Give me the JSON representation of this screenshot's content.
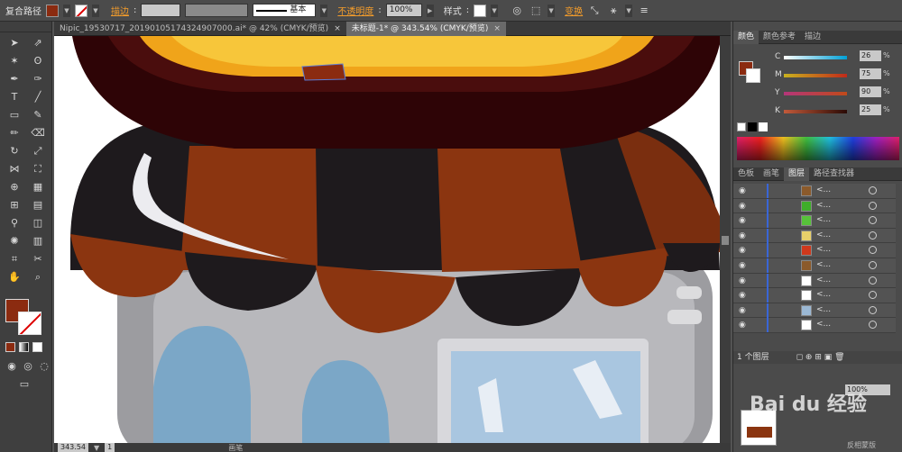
{
  "control_bar": {
    "object_type": "复合路径",
    "fill_color": "#8b2b10",
    "stroke_label": "描边",
    "stroke_profile": "基本",
    "opacity_label": "不透明度",
    "opacity_value": "100%",
    "style_label": "样式",
    "transform_label": "变换"
  },
  "tabs": [
    {
      "label": "Nipic_19530717_20190105174324907000.ai* @ 42% (CMYK/预览)",
      "active": false
    },
    {
      "label": "未标题-1* @ 343.54% (CMYK/预览)",
      "active": true
    }
  ],
  "color_panel": {
    "tabs": [
      "颜色",
      "颜色参考",
      "描边"
    ],
    "channels": [
      {
        "name": "C",
        "value": "26",
        "color": "#c02a1a"
      },
      {
        "name": "M",
        "value": "75",
        "color": "#d4b21e"
      },
      {
        "name": "Y",
        "value": "90",
        "color": "#b4367a"
      },
      {
        "name": "K",
        "value": "25",
        "color": "#8b8b8b"
      }
    ],
    "percent": "%"
  },
  "layers_panel": {
    "tabs": [
      "色板",
      "画笔",
      "图层",
      "路径查找器"
    ],
    "rows": [
      {
        "name": "<...",
        "thumb": "#8b5a2b"
      },
      {
        "name": "<...",
        "thumb": "#3fae2a"
      },
      {
        "name": "<...",
        "thumb": "#57c23a"
      },
      {
        "name": "<...",
        "thumb": "#e8d06a"
      },
      {
        "name": "<...",
        "thumb": "#d0391c"
      },
      {
        "name": "<...",
        "thumb": "#8b5a2b"
      },
      {
        "name": "<...",
        "thumb": "#ffffff"
      },
      {
        "name": "<...",
        "thumb": "#ffffff"
      },
      {
        "name": "<...",
        "thumb": "#9bb8d4"
      },
      {
        "name": "<...",
        "thumb": "#ffffff"
      }
    ],
    "footer": "1 个图层"
  },
  "transparency_panel": {
    "opacity_value": "100%",
    "footer_label": "反相蒙版"
  },
  "status_bar": {
    "zoom": "343.54",
    "page": "1",
    "tool": "画笔"
  },
  "watermark": "Bai du 经验"
}
